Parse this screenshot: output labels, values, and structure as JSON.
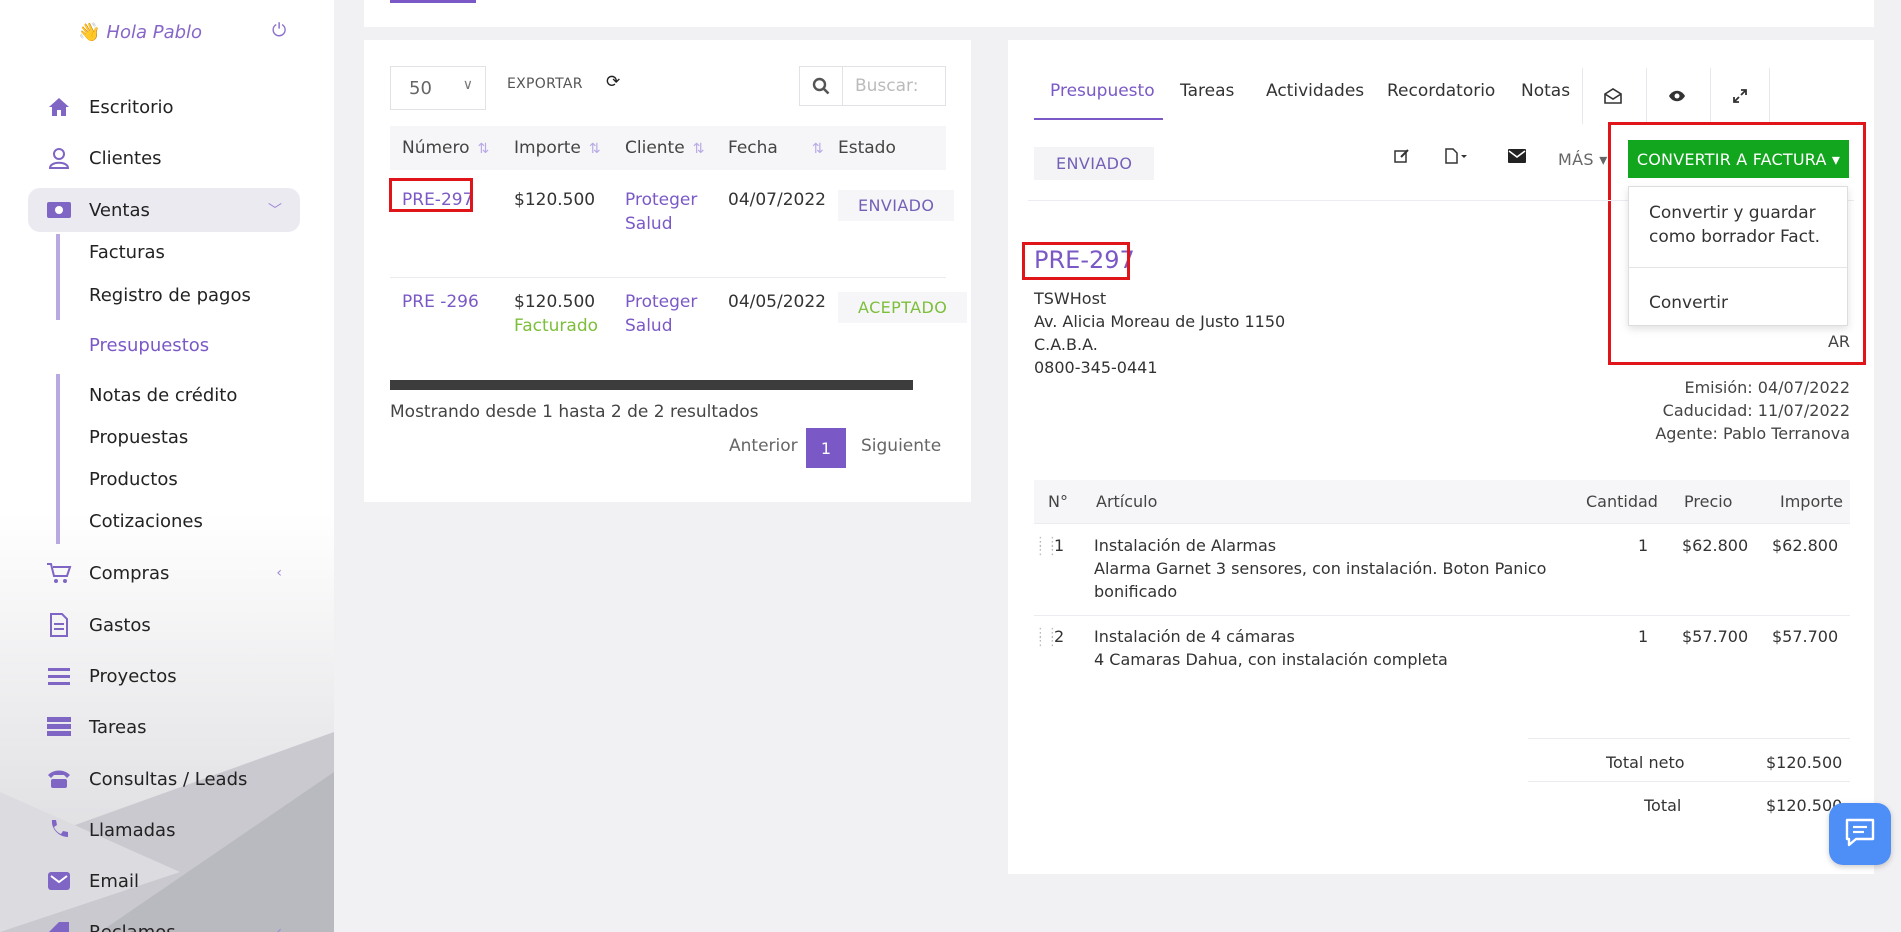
{
  "sidebar": {
    "greeting": "Hola Pablo",
    "items": [
      {
        "label": "Escritorio",
        "icon": "home-icon"
      },
      {
        "label": "Clientes",
        "icon": "user-icon"
      },
      {
        "label": "Ventas",
        "icon": "money-icon"
      },
      {
        "label": "Compras",
        "icon": "cart-icon"
      },
      {
        "label": "Gastos",
        "icon": "file-icon"
      },
      {
        "label": "Proyectos",
        "icon": "bars-icon"
      },
      {
        "label": "Tareas",
        "icon": "tasks-icon"
      },
      {
        "label": "Consultas / Leads",
        "icon": "phone-icon"
      },
      {
        "label": "Llamadas",
        "icon": "call-icon"
      },
      {
        "label": "Email",
        "icon": "mail-icon"
      },
      {
        "label": "Reclamos",
        "icon": "tag-icon"
      }
    ],
    "ventas_sub": [
      "Facturas",
      "Registro de pagos",
      "Presupuestos",
      "Notas de crédito",
      "Propuestas",
      "Productos",
      "Cotizaciones"
    ]
  },
  "list": {
    "page_size": "50",
    "export_label": "EXPORTAR",
    "search_placeholder": "Buscar:",
    "columns": [
      "Número",
      "Importe",
      "Cliente",
      "Fecha",
      "Estado"
    ],
    "rows": [
      {
        "numero": "PRE-297",
        "importe": "$120.500",
        "importe_sub": "",
        "cliente_1": "Proteger",
        "cliente_2": "Salud",
        "fecha": "04/07/2022",
        "estado": "ENVIADO"
      },
      {
        "numero": "PRE -296",
        "importe": "$120.500",
        "importe_sub": "Facturado",
        "cliente_1": "Proteger",
        "cliente_2": "Salud",
        "fecha": "04/05/2022",
        "estado": "ACEPTADO"
      }
    ],
    "showing": "Mostrando desde 1 hasta 2 de 2 resultados",
    "prev": "Anterior",
    "page": "1",
    "next": "Siguiente"
  },
  "detail": {
    "tabs": [
      "Presupuesto",
      "Tareas",
      "Actividades",
      "Recordatorio",
      "Notas"
    ],
    "status": "ENVIADO",
    "mas": "MÁS",
    "convert_label": "CONVERTIR A FACTURA",
    "dropdown": {
      "item1_line1": "Convertir y guardar",
      "item1_line2": "como borrador Fact.",
      "item2": "Convertir"
    },
    "doc_number": "PRE-297",
    "company": "TSWHost",
    "address1": "Av. Alicia Moreau de Justo 1150",
    "address2": "C.A.B.A.",
    "phone": "0800-345-0441",
    "country": "AR",
    "emision": "Emisión: 04/07/2022",
    "caducidad": "Caducidad: 11/07/2022",
    "agente": "Agente: Pablo Terranova",
    "item_columns": {
      "n": "N°",
      "articulo": "Artículo",
      "cantidad": "Cantidad",
      "precio": "Precio",
      "importe": "Importe"
    },
    "items": [
      {
        "n": "1",
        "title": "Instalación de Alarmas",
        "desc1": "Alarma Garnet 3 sensores, con instalación. Boton Panico",
        "desc2": "bonificado",
        "cantidad": "1",
        "precio": "$62.800",
        "importe": "$62.800"
      },
      {
        "n": "2",
        "title": "Instalación de 4 cámaras",
        "desc1": "4 Camaras Dahua, con instalación completa",
        "desc2": "",
        "cantidad": "1",
        "precio": "$57.700",
        "importe": "$57.700"
      }
    ],
    "total_neto_label": "Total neto",
    "total_neto": "$120.500",
    "total_label": "Total",
    "total": "$120.500"
  },
  "colors": {
    "accent": "#7a59c6",
    "convert": "#12a51e",
    "highlight": "#e0151a",
    "chat": "#4e8ef7"
  }
}
